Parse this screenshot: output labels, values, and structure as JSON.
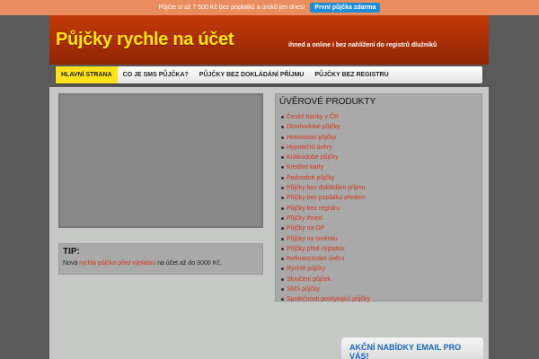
{
  "promo": {
    "text": "Půjčte si až 7 500 Kč bez poplatků a úroků jen dnes!",
    "button": "První půjčka zdarma"
  },
  "header": {
    "title": "Půjčky rychle na účet",
    "tagline": "ihned a online i bez nahlížení do registrů dlužníků"
  },
  "nav": {
    "items": [
      {
        "label": "HLAVNÍ STRANA",
        "active": true
      },
      {
        "label": "CO JE SMS PŮJČKA?",
        "active": false
      },
      {
        "label": "PŮJČKY BEZ DOKLÁDÁNÍ PŘÍJMU",
        "active": false
      },
      {
        "label": "PŮJČKY BEZ REGISTRU",
        "active": false
      }
    ]
  },
  "tip": {
    "title": "TIP:",
    "prefix": "Nová ",
    "link": "rychlá půjčka před výplatou",
    "suffix": " na účet až do 3000 Kč."
  },
  "products": {
    "title": "ÚVĚROVÉ PRODUKTY",
    "items": [
      "České banky v ČR",
      "Dlouhodobé půjčky",
      "Hotovostní půjčky",
      "Hypoteční úvěry",
      "Krátkodobé půjčky",
      "Kreditní karty",
      "Podvodné půjčky",
      "Půjčky bez dokládání příjmu",
      "Půjčky bez poplatku předem",
      "Půjčky bez registru",
      "Půjčky ihned",
      "Půjčky na OP",
      "Půjčky na směnku",
      "Půjčky před výplatou",
      "Refinancování úvěru",
      "Rychlé půjčky",
      "Sloučení půjček",
      "SMS půjčky",
      "Společnosti poskytující půjčky"
    ]
  },
  "email": {
    "title": "AKČNÍ NABÍDKY EMAIL PRO VÁS!"
  }
}
